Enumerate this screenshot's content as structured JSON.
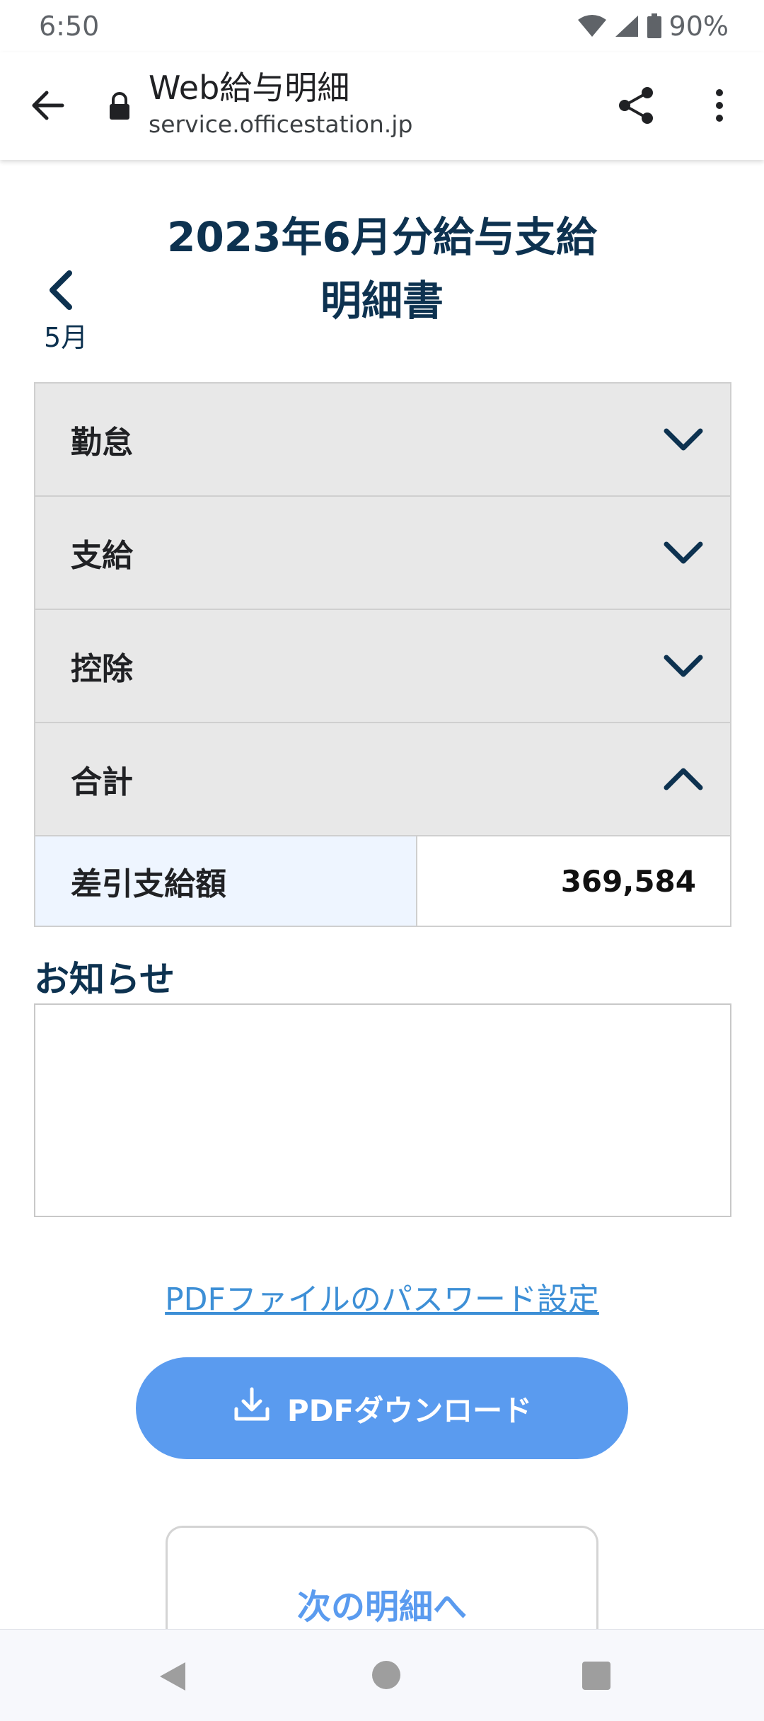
{
  "status_bar": {
    "time": "6:50",
    "battery": "90%"
  },
  "browser": {
    "title": "Web給与明細",
    "url": "service.officestation.jp"
  },
  "page": {
    "title_line1": "2023年6月分給与支給",
    "title_line2": "明細書",
    "prev_month_label": "5月"
  },
  "sections": [
    {
      "label": "勤怠",
      "expanded": false
    },
    {
      "label": "支給",
      "expanded": false
    },
    {
      "label": "控除",
      "expanded": false
    },
    {
      "label": "合計",
      "expanded": true
    }
  ],
  "total": {
    "label": "差引支給額",
    "value": "369,584"
  },
  "notice": {
    "heading": "お知らせ",
    "content": ""
  },
  "actions": {
    "pdf_password_link": "PDFファイルのパスワード設定",
    "pdf_download": "PDFダウンロード",
    "next_statement": "次の明細へ"
  },
  "colors": {
    "heading": "#0d3250",
    "accent_blue": "#5a9bef",
    "link_blue": "#3d8fd6",
    "section_bg": "#e8e8e8",
    "total_label_bg": "#eef5ff"
  }
}
